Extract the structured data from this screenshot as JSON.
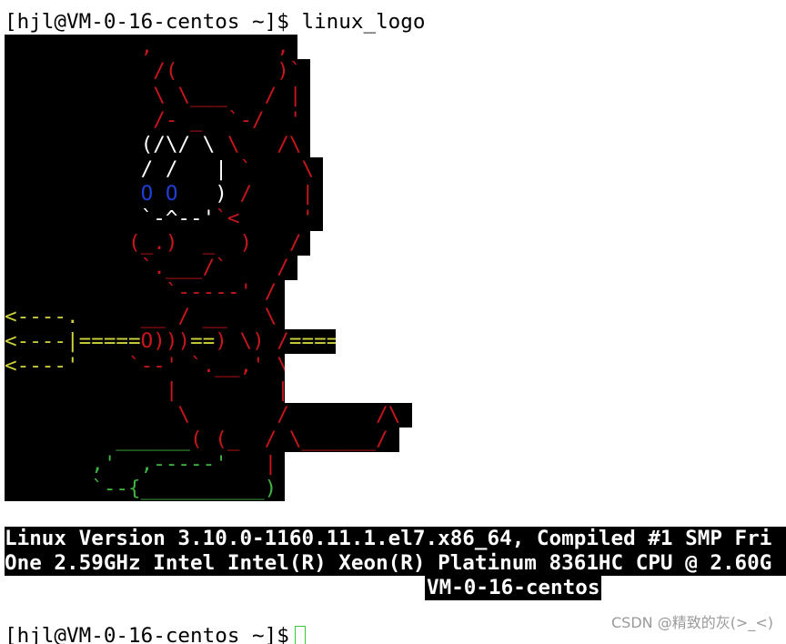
{
  "terminal": {
    "prompt_line_1": "[hjl@VM-0-16-centos ~]$ linux_logo",
    "prompt_line_2": "[hjl@VM-0-16-centos ~]$",
    "logo_rows": [
      {
        "segments": [
          {
            "c": "red",
            "t": "           ,          , "
          }
        ]
      },
      {
        "segments": [
          {
            "c": "red",
            "t": "            /(        )` "
          }
        ]
      },
      {
        "segments": [
          {
            "c": "red",
            "t": "            \\ \\___   / | "
          }
        ]
      },
      {
        "segments": [
          {
            "c": "red",
            "t": "            /- _  `-/  ' "
          }
        ]
      },
      {
        "segments": [
          {
            "c": "red",
            "t": "           "
          },
          {
            "c": "white",
            "t": "(/\\/ \\"
          },
          {
            "c": "red",
            "t": " \\   /\\ "
          }
        ]
      },
      {
        "segments": [
          {
            "c": "white",
            "t": "           / /   |"
          },
          {
            "c": "red",
            "t": " `    \\ "
          }
        ]
      },
      {
        "segments": [
          {
            "c": "blue",
            "t": "           O O   "
          },
          {
            "c": "white",
            "t": ")"
          },
          {
            "c": "red",
            "t": " /    | "
          }
        ]
      },
      {
        "segments": [
          {
            "c": "white",
            "t": "           `-^--'"
          },
          {
            "c": "red",
            "t": "`<     ' "
          }
        ]
      },
      {
        "segments": [
          {
            "c": "red",
            "t": "          (_.)  _  )   / "
          }
        ]
      },
      {
        "segments": [
          {
            "c": "red",
            "t": "           `.___/`    / "
          }
        ]
      },
      {
        "segments": [
          {
            "c": "red",
            "t": "             `-----' / "
          }
        ]
      },
      {
        "segments": [
          {
            "c": "yellow",
            "t": "<----."
          },
          {
            "c": "red",
            "t": "     __ / __   \\ "
          }
        ]
      },
      {
        "segments": [
          {
            "c": "yellow",
            "t": "<----|====="
          },
          {
            "c": "red",
            "t": "O)))"
          },
          {
            "c": "yellow",
            "t": "=="
          },
          {
            "c": "red",
            "t": ") \\) /"
          },
          {
            "c": "yellow",
            "t": "===="
          }
        ]
      },
      {
        "segments": [
          {
            "c": "yellow",
            "t": "<----'"
          },
          {
            "c": "red",
            "t": "    `--' `.__,' \\ "
          }
        ]
      },
      {
        "segments": [
          {
            "c": "red",
            "t": "             |        | "
          }
        ]
      },
      {
        "segments": [
          {
            "c": "red",
            "t": "              \\       /       /\\ "
          }
        ]
      },
      {
        "segments": [
          {
            "c": "green",
            "t": "         ______"
          },
          {
            "c": "red",
            "t": "( (_  / \\______/ "
          }
        ]
      },
      {
        "segments": [
          {
            "c": "green",
            "t": "       ,'  ,-----'   "
          },
          {
            "c": "red",
            "t": "| "
          }
        ]
      },
      {
        "segments": [
          {
            "c": "green",
            "t": "       `--{__________)"
          }
        ]
      }
    ],
    "info_line_1": "Linux Version 3.10.0-1160.11.1.el7.x86_64, Compiled #1 SMP Fri",
    "info_line_2": "One 2.59GHz Intel Intel(R) Xeon(R) Platinum 8361HC CPU @ 2.60G",
    "info_host": "VM-0-16-centos",
    "watermark": "CSDN @精致的灰(>_<)"
  },
  "colors": {
    "red": "#c8161d",
    "white": "#ffffff",
    "blue": "#1f3ed8",
    "yellow": "#cfd33c",
    "green": "#40b440",
    "cursor": "#37c837"
  }
}
